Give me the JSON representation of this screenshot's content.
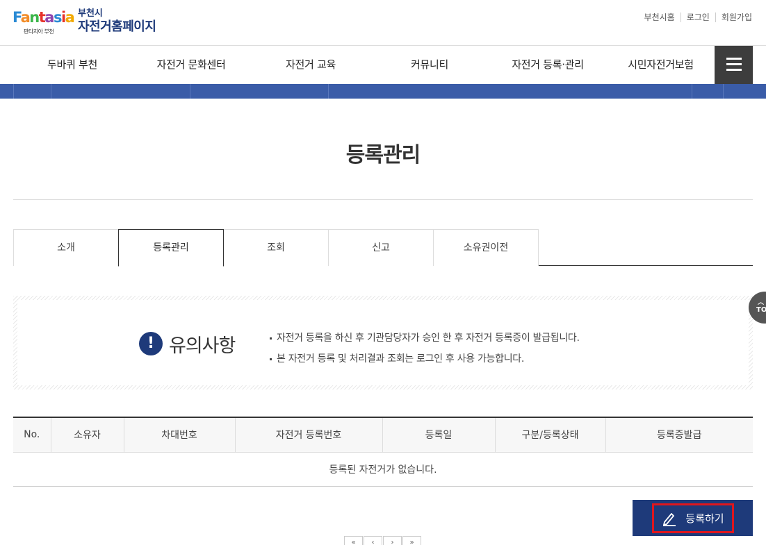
{
  "header": {
    "logo_text": [
      "F",
      "a",
      "n",
      "t",
      "a",
      "s",
      "i",
      "a",
      ""
    ],
    "logo_sub": "판타지아 부천",
    "site_city": "부천시",
    "site_name": "자전거홈페이지",
    "util_links": [
      "부천시홈",
      "로그인",
      "회원가입"
    ]
  },
  "gnb": {
    "items": [
      "두바퀴 부천",
      "자전거 문화센터",
      "자전거 교육",
      "커뮤니티",
      "자전거 등록·관리",
      "시민자전거보험"
    ],
    "menu_icon": "hamburger-icon"
  },
  "page": {
    "title": "등록관리"
  },
  "tabs": {
    "items": [
      "소개",
      "등록관리",
      "조회",
      "신고",
      "소유권이전"
    ],
    "active": "등록관리"
  },
  "notice": {
    "icon": "exclamation-icon",
    "icon_glyph": "!",
    "heading": "유의사항",
    "items": [
      "자전거 등록을 하신 후 기관담당자가 승인 한 후 자전거 등록증이 발급됩니다.",
      "본 자전거 등록 및 처리결과 조회는 로그인 후 사용 가능합니다."
    ]
  },
  "table": {
    "headers": [
      "No.",
      "소유자",
      "차대번호",
      "자전거 등록번호",
      "등록일",
      "구분/등록상태",
      "등록증발급"
    ],
    "empty_message": "등록된 자전거가 없습니다."
  },
  "actions": {
    "register_label": "등록하기",
    "register_icon": "pencil-icon"
  },
  "top_button": {
    "label": "TO",
    "icon": "chevron-up-icon"
  },
  "colors": {
    "brand_navy": "#1e3a7a",
    "strip_blue": "#3a5ca8",
    "menu_dark": "#3d3d3d",
    "highlight_red": "#e0161d"
  }
}
